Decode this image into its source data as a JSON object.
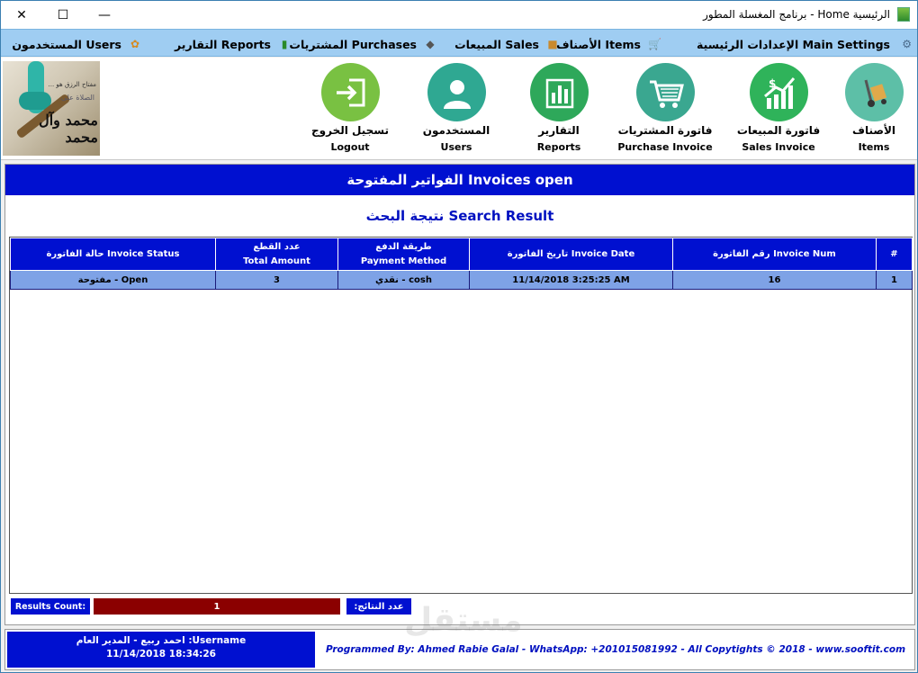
{
  "window": {
    "title": "الرئيسية Home - برنامج المغسلة المطور",
    "close_glyph": "✕",
    "maximize_glyph": "☐",
    "minimize_glyph": "—"
  },
  "menu": {
    "settings": "الإعدادات الرئيسية Main Settings",
    "items": "الأصناف Items",
    "sales": "المبيعات Sales",
    "purchases": "المشتريات Purchases",
    "reports": "التقارير Reports",
    "users": "المستخدمون Users"
  },
  "logo": {
    "line1": "مفتاح الرزق هو ...",
    "line2": "الصلاة على",
    "line3": "محمد وآل محمد"
  },
  "toolbar": {
    "items": {
      "ar": "الأصناف",
      "en": "Items"
    },
    "sales_invoice": {
      "ar": "فاتورة المبيعات",
      "en": "Sales Invoice"
    },
    "purchase_invoice": {
      "ar": "فاتورة المشتريات",
      "en": "Purchase Invoice"
    },
    "reports": {
      "ar": "التقارير",
      "en": "Reports"
    },
    "users": {
      "ar": "المستخدمون",
      "en": "Users"
    },
    "logout": {
      "ar": "تسجيل الخروج",
      "en": "Logout"
    }
  },
  "main": {
    "header": "الفواتير المفتوحة Invoices open",
    "search_result": "نتيجة البحث Search Result",
    "columns": {
      "status": "حالة الفاتورة Invoice Status",
      "total_ar": "عدد القطع",
      "total_en": "Total Amount",
      "payment_ar": "طريقة الدفع",
      "payment_en": "Payment Method",
      "date": "تاريخ الفاتورة Invoice Date",
      "num": "رقم الفاتورة Invoice Num",
      "hash": "#"
    },
    "rows": [
      {
        "status": "مفتوحة - Open",
        "total": "3",
        "payment": "نقدي - cosh",
        "date": "11/14/2018 3:25:25 AM",
        "num": "16",
        "index": "1"
      }
    ],
    "results_count_label_en": "Results Count:",
    "results_count_value": "1",
    "results_count_label_ar": "عدد النتائج:"
  },
  "footer": {
    "username": "Username: احمد ربيع - المدير العام",
    "datetime": "11/14/2018 18:34:26",
    "credit": "Programmed By: Ahmed Rabie Galal - WhatsApp: +201015081992 - All Copytights © 2018 - www.sooftit.com"
  },
  "watermark": "مستقل",
  "colors": {
    "menubar": "#9fcdf2",
    "header_blue": "#0010d0",
    "row_blue": "#7ea2e6",
    "count_red": "#8b0000"
  }
}
